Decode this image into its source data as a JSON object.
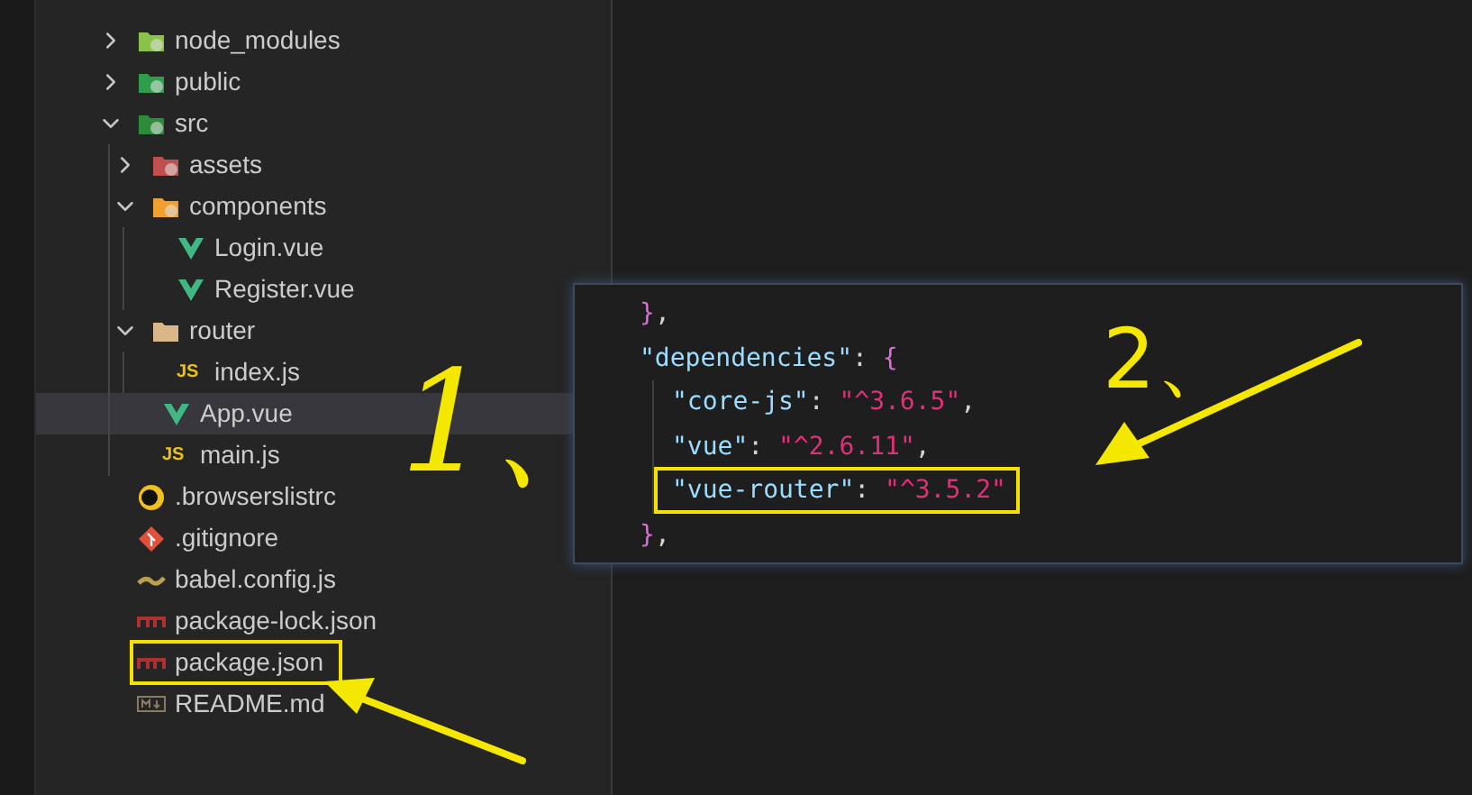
{
  "explorer": {
    "items": [
      {
        "label": "node_modules",
        "kind": "folder-node",
        "expanded": false,
        "selected": false,
        "annotated": false
      },
      {
        "label": "public",
        "kind": "folder-public",
        "expanded": false,
        "selected": false,
        "annotated": false
      },
      {
        "label": "src",
        "kind": "folder-src",
        "expanded": true,
        "selected": false,
        "annotated": false,
        "children": [
          {
            "label": "assets",
            "kind": "folder-assets",
            "expanded": false,
            "selected": false,
            "annotated": false
          },
          {
            "label": "components",
            "kind": "folder-components",
            "expanded": true,
            "selected": false,
            "annotated": false,
            "children": [
              {
                "label": "Login.vue",
                "kind": "vue",
                "selected": false,
                "annotated": false
              },
              {
                "label": "Register.vue",
                "kind": "vue",
                "selected": false,
                "annotated": false
              }
            ]
          },
          {
            "label": "router",
            "kind": "folder-router",
            "expanded": true,
            "selected": false,
            "annotated": false,
            "children": [
              {
                "label": "index.js",
                "kind": "js",
                "icon_text": "JS",
                "selected": false,
                "annotated": false
              }
            ]
          },
          {
            "label": "App.vue",
            "kind": "vue",
            "selected": true,
            "annotated": false
          },
          {
            "label": "main.js",
            "kind": "js",
            "icon_text": "JS",
            "selected": false,
            "annotated": false
          }
        ]
      },
      {
        "label": ".browserslistrc",
        "kind": "browserslist",
        "selected": false,
        "annotated": false
      },
      {
        "label": ".gitignore",
        "kind": "git",
        "selected": false,
        "annotated": false
      },
      {
        "label": "babel.config.js",
        "kind": "babel",
        "selected": false,
        "annotated": false
      },
      {
        "label": "package-lock.json",
        "kind": "npm",
        "selected": false,
        "annotated": false
      },
      {
        "label": "package.json",
        "kind": "npm",
        "selected": false,
        "annotated": true
      },
      {
        "label": "README.md",
        "kind": "markdown",
        "selected": false,
        "annotated": false
      }
    ]
  },
  "code_popup": {
    "lines": [
      {
        "annotated": false,
        "tokens": [
          {
            "kind": "brace",
            "text": "}"
          },
          {
            "kind": "punct",
            "text": ","
          }
        ]
      },
      {
        "annotated": false,
        "tokens": [
          {
            "kind": "key",
            "text": "\"dependencies\""
          },
          {
            "kind": "punct",
            "text": ": "
          },
          {
            "kind": "brace",
            "text": "{"
          }
        ],
        "children": [
          {
            "annotated": false,
            "tokens": [
              {
                "kind": "key",
                "text": "\"core-js\""
              },
              {
                "kind": "punct",
                "text": ": "
              },
              {
                "kind": "string",
                "text": "\"^3.6.5\""
              },
              {
                "kind": "punct",
                "text": ","
              }
            ]
          },
          {
            "annotated": false,
            "tokens": [
              {
                "kind": "key",
                "text": "\"vue\""
              },
              {
                "kind": "punct",
                "text": ": "
              },
              {
                "kind": "string",
                "text": "\"^2.6.11\""
              },
              {
                "kind": "punct",
                "text": ","
              }
            ]
          },
          {
            "annotated": true,
            "tokens": [
              {
                "kind": "key",
                "text": "\"vue-router\""
              },
              {
                "kind": "punct",
                "text": ": "
              },
              {
                "kind": "string",
                "text": "\"^3.5.2\""
              }
            ]
          }
        ]
      },
      {
        "annotated": false,
        "tokens": [
          {
            "kind": "brace",
            "text": "}"
          },
          {
            "kind": "punct",
            "text": ","
          }
        ]
      }
    ]
  },
  "annotations": [
    {
      "label": "1、"
    },
    {
      "label": "2、"
    }
  ]
}
